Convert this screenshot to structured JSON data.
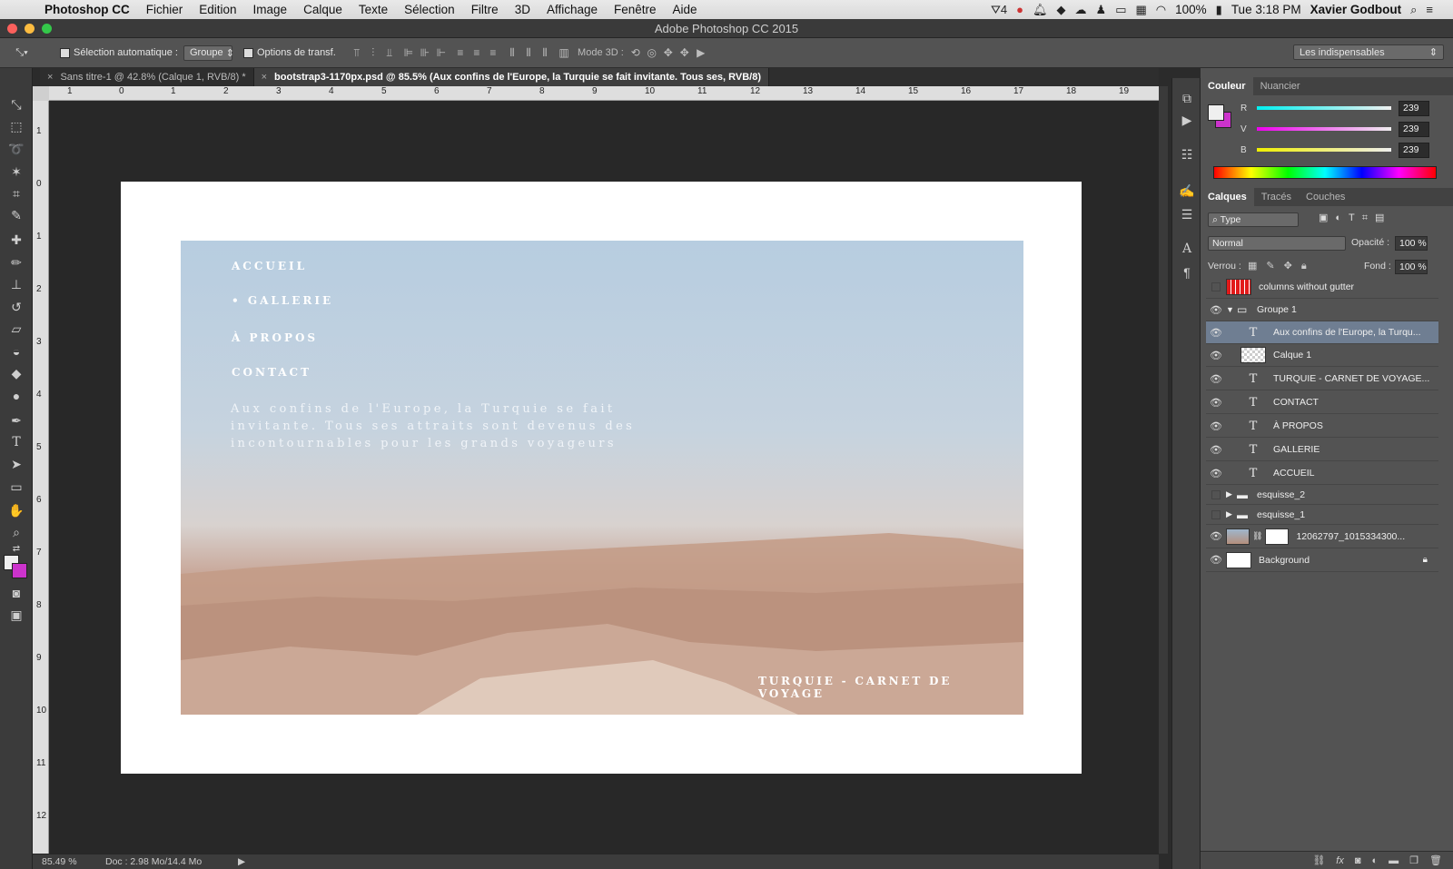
{
  "menubar": {
    "app": "Photoshop CC",
    "items": [
      "Fichier",
      "Edition",
      "Image",
      "Calque",
      "Texte",
      "Sélection",
      "Filtre",
      "3D",
      "Affichage",
      "Fenêtre",
      "Aide"
    ],
    "status_count": "4",
    "battery": "100%",
    "clock": "Tue 3:18 PM",
    "user": "Xavier Godbout"
  },
  "window": {
    "title": "Adobe Photoshop CC 2015"
  },
  "options": {
    "auto_select_label": "Sélection automatique :",
    "auto_select_value": "Groupe",
    "transform_label": "Options de transf.",
    "mode3d_label": "Mode 3D :",
    "workspace": "Les indispensables"
  },
  "tabs": [
    {
      "label": "Sans titre-1 @ 42.8% (Calque 1, RVB/8) *"
    },
    {
      "label": "bootstrap3-1170px.psd @ 85.5% (Aux confins de l'Europe, la Turquie se fait invitante. Tous ses, RVB/8)"
    }
  ],
  "rulers": {
    "top": [
      "1",
      "0",
      "1",
      "2",
      "3",
      "4",
      "5",
      "6",
      "7",
      "8",
      "9",
      "10",
      "11",
      "12",
      "13",
      "14",
      "15",
      "16",
      "17",
      "18",
      "19"
    ],
    "left": [
      "1",
      "0",
      "1",
      "2",
      "3",
      "4",
      "5",
      "6",
      "7",
      "8",
      "9",
      "10",
      "11",
      "12"
    ]
  },
  "document": {
    "nav": [
      "ACCUEIL",
      "• GALLERIE",
      "À PROPOS",
      "CONTACT"
    ],
    "hero_lines": [
      "Aux confins de l'Europe, la Turquie se fait",
      "invitante. Tous ses attraits sont devenus des",
      "incontournables pour les grands voyageurs"
    ],
    "footer_title": "TURQUIE - CARNET DE VOYAGE"
  },
  "status": {
    "zoom": "85.49 %",
    "doc": "Doc : 2.98 Mo/14.4 Mo"
  },
  "color_panel": {
    "tabs": [
      "Couleur",
      "Nuancier"
    ],
    "sliders": [
      {
        "label": "R",
        "value": "239"
      },
      {
        "label": "V",
        "value": "239"
      },
      {
        "label": "B",
        "value": "239"
      }
    ]
  },
  "layers_panel": {
    "tabs": [
      "Calques",
      "Tracés",
      "Couches"
    ],
    "filter": "Type",
    "blend_mode": "Normal",
    "opacity_label": "Opacité :",
    "opacity": "100 %",
    "lock_label": "Verrou :",
    "fill_label": "Fond :",
    "fill": "100 %",
    "layers": [
      {
        "name": "columns without gutter"
      },
      {
        "name": "Groupe 1"
      },
      {
        "name": "Aux confins de l'Europe, la Turqu..."
      },
      {
        "name": "Calque 1"
      },
      {
        "name": "TURQUIE - CARNET DE VOYAGE..."
      },
      {
        "name": "CONTACT"
      },
      {
        "name": "À PROPOS"
      },
      {
        "name": "GALLERIE"
      },
      {
        "name": "ACCUEIL"
      },
      {
        "name": "esquisse_2"
      },
      {
        "name": "esquisse_1"
      },
      {
        "name": "12062797_1015334300..."
      },
      {
        "name": "Background"
      }
    ]
  },
  "colors": {
    "accent_selection": "#6f7e92",
    "foreground": "#efefef",
    "background_swatch": "#cc33cc"
  }
}
